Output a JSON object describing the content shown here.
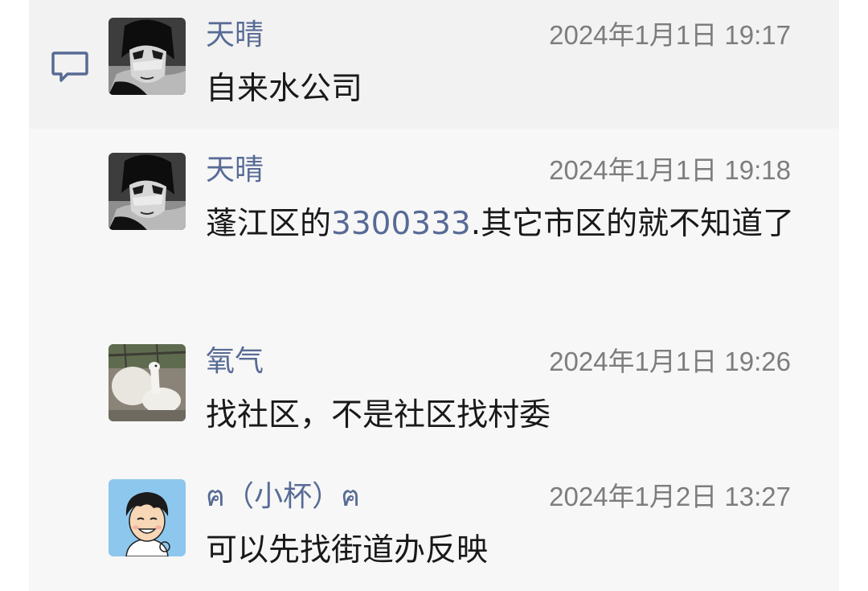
{
  "messages": [
    {
      "name": "天晴",
      "time": "2024年1月1日 19:17",
      "text": "自来水公司",
      "avatar": "dark-anime-avatar"
    },
    {
      "name": "天晴",
      "time": "2024年1月1日 19:18",
      "text_before": "蓬江区的",
      "link": "3300333",
      "text_after": ".其它市区的就不知道了",
      "avatar": "dark-anime-avatar"
    },
    {
      "name": "氧气",
      "time": "2024年1月1日 19:26",
      "text": "找社区，不是社区找村委",
      "avatar": "alpaca-photo-avatar"
    },
    {
      "name": "ฅ（小杯）ฅ",
      "time": "2024年1月2日 13:27",
      "text": "可以先找街道办反映",
      "avatar": "cartoon-boy-avatar"
    }
  ],
  "icons": {
    "comment": "comment-bubble-icon"
  },
  "colors": {
    "name": "#576b95",
    "link": "#576b95",
    "time": "#7d7d7d",
    "text": "#191919",
    "panel": "#f7f7f7"
  }
}
